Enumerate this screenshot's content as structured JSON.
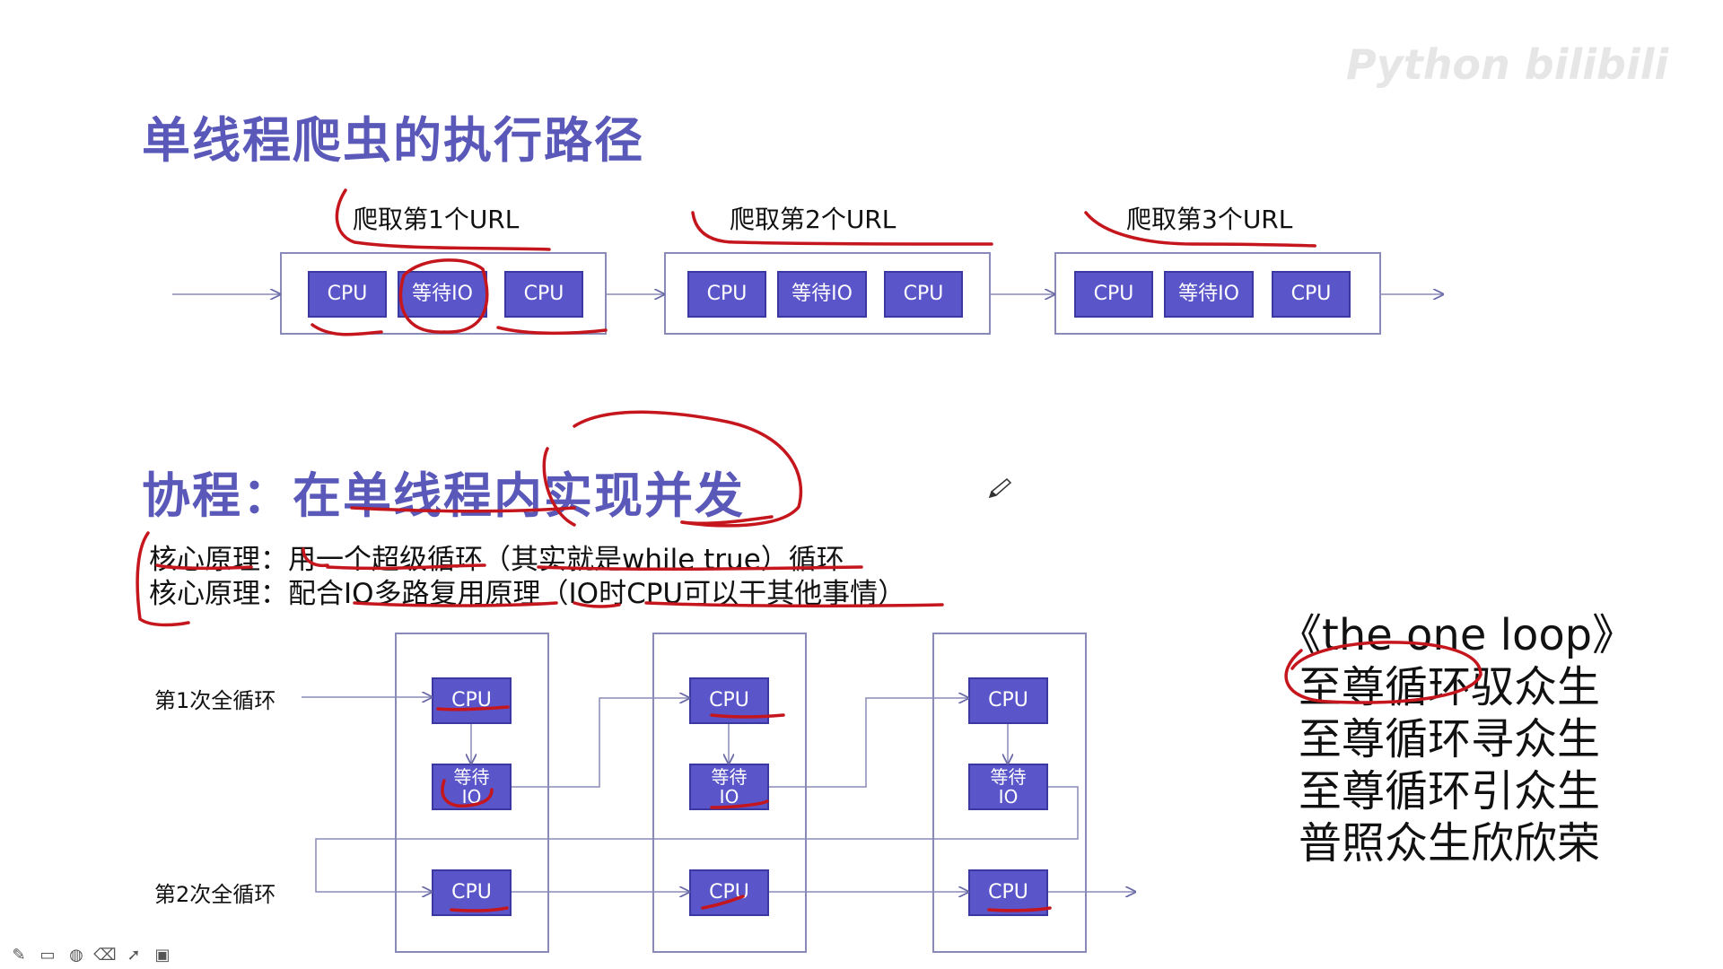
{
  "watermark": {
    "text": "Python bilibili"
  },
  "section1": {
    "title": "单线程爬虫的执行路径",
    "urls": [
      "爬取第1个URL",
      "爬取第2个URL",
      "爬取第3个URL"
    ],
    "steps": [
      "CPU",
      "等待IO",
      "CPU"
    ]
  },
  "section2": {
    "title": "协程：在单线程内实现并发",
    "lines": [
      "核心原理：用一个超级循环（其实就是while true）循环",
      "核心原理：配合IO多路复用原理（IO时CPU可以干其他事情）"
    ],
    "loops": [
      "第1次全循环",
      "第2次全循环"
    ],
    "cpu": "CPU",
    "wait_io_line1": "等待",
    "wait_io_line2": "IO"
  },
  "poem": {
    "title": "《the one loop》",
    "lines": [
      "至尊循环驭众生",
      "至尊循环寻众生",
      "至尊循环引众生",
      "普照众生欣欣荣"
    ]
  },
  "toolbar": {
    "icons": [
      "pen-icon",
      "window-icon",
      "palette-icon",
      "eraser-icon",
      "pointer-icon",
      "screen-icon"
    ]
  },
  "colors": {
    "title": "#5a58b8",
    "box": "#5a55c8",
    "ink": "#c4161c"
  }
}
